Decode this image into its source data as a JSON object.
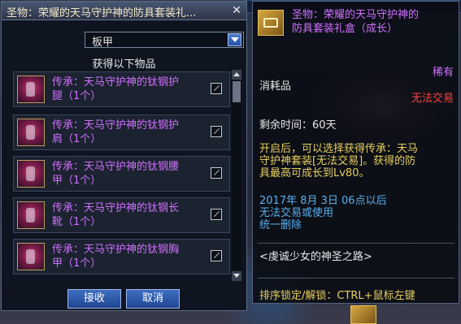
{
  "dialog": {
    "title": "圣物：荣耀的天马守护神的防具套装礼...",
    "close_glyph": "✕",
    "select_value": "板甲",
    "get_label": "获得以下物品",
    "items": [
      {
        "line1": "传承：天马守护神的钛钢护",
        "line2": "腿（1个）"
      },
      {
        "line1": "传承：天马守护神的钛钢护",
        "line2": "肩（1个）"
      },
      {
        "line1": "传承：天马守护神的钛钢腰",
        "line2": "甲（1个）"
      },
      {
        "line1": "传承：天马守护神的钛钢长",
        "line2": "靴（1个）"
      },
      {
        "line1": "传承：天马守护神的钛钢胸",
        "line2": "甲（1个）"
      }
    ],
    "accept_label": "接收",
    "cancel_label": "取消"
  },
  "tooltip": {
    "title_line1": "圣物：荣耀的天马守护神的",
    "title_line2": "防具套装礼盒（成长）",
    "rarity": "稀有",
    "type": "消耗品",
    "trade": "无法交易",
    "remaining": "剩余时间：60天",
    "desc_line1": "开启后，可以选择获得传承：天马",
    "desc_line2": "守护神套装[无法交易]。获得的防",
    "desc_line3": "具最高可成长到Lv80。",
    "date_line1": "2017年 8月 3日 06点以后",
    "date_line2": "无法交易或使用",
    "date_line3": "统一删除",
    "quote": "<虔诚少女的神圣之路>",
    "lock_hint": "排序锁定/解锁：CTRL+鼠标左键"
  },
  "colors": {
    "epic_text": "#d070ff",
    "untradeable": "#ff4040",
    "description": "#e8d060",
    "date_text": "#5ab0f0"
  }
}
